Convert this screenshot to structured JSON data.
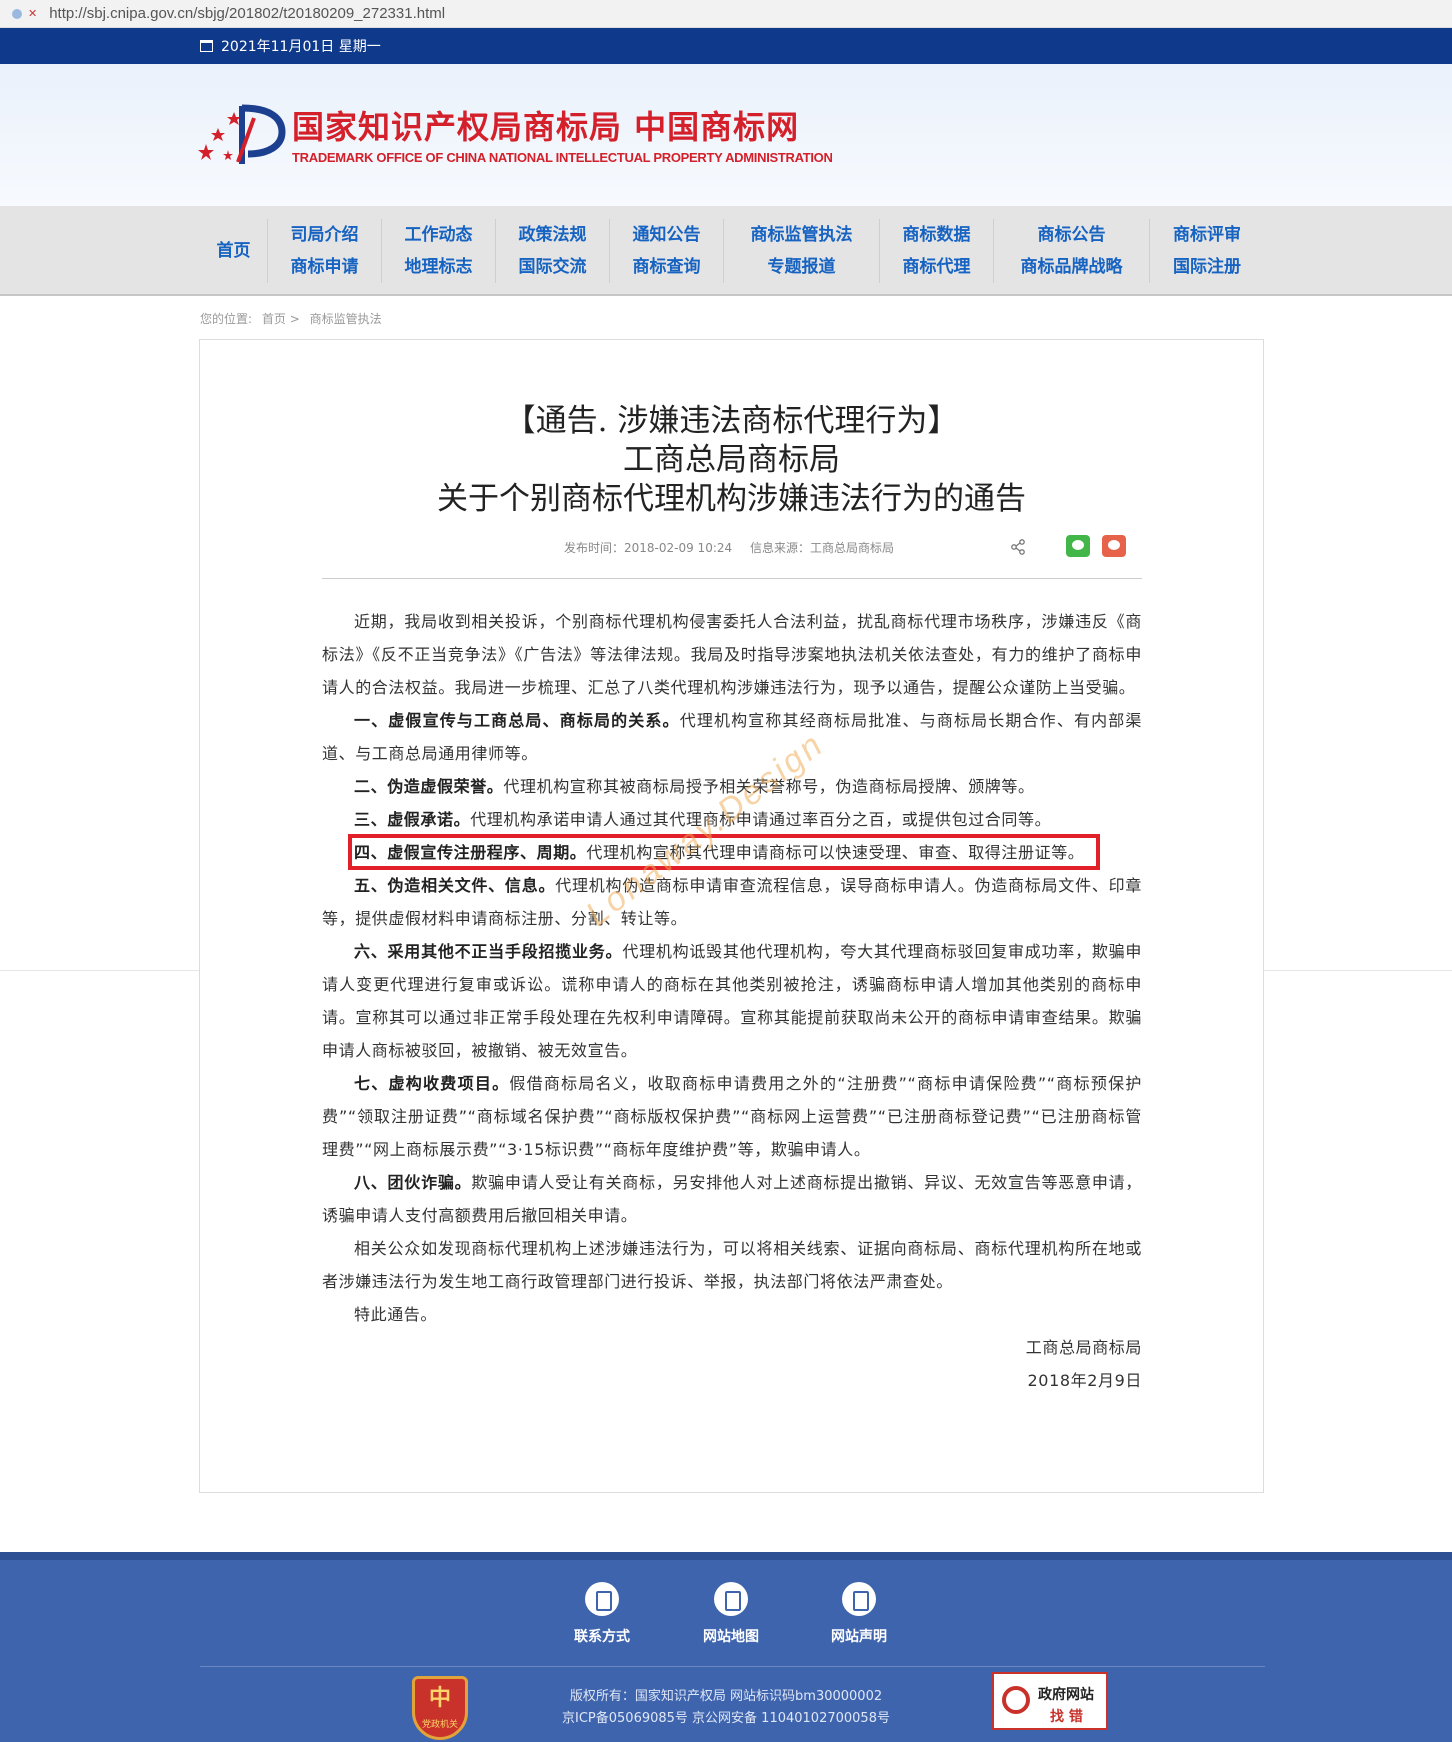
{
  "browser": {
    "url": "http://sbj.cnipa.gov.cn/sbjg/201802/t20180209_272331.html"
  },
  "topbar": {
    "date": "2021年11月01日 星期一"
  },
  "header": {
    "logo_cn": "国家知识产权局商标局 中国商标网",
    "logo_en": "TRADEMARK OFFICE OF CHINA NATIONAL INTELLECTUAL PROPERTY ADMINISTRATION",
    "brand_color": "#d3202a"
  },
  "nav": [
    {
      "top": "首页",
      "bottom": ""
    },
    {
      "top": "司局介绍",
      "bottom": "商标申请"
    },
    {
      "top": "工作动态",
      "bottom": "地理标志"
    },
    {
      "top": "政策法规",
      "bottom": "国际交流"
    },
    {
      "top": "通知公告",
      "bottom": "商标查询"
    },
    {
      "top": "商标监管执法",
      "bottom": "专题报道"
    },
    {
      "top": "商标数据",
      "bottom": "商标代理"
    },
    {
      "top": "商标公告",
      "bottom": "商标品牌战略"
    },
    {
      "top": "商标评审",
      "bottom": "国际注册"
    }
  ],
  "breadcrumb": {
    "label": "您的位置:",
    "home": "首页 >",
    "current": "商标监管执法"
  },
  "article": {
    "title_1": "【通告. 涉嫌违法商标代理行为】",
    "title_2": "工商总局商标局",
    "title_3": "关于个别商标代理机构涉嫌违法行为的通告",
    "publish_time": "发布时间：2018-02-09 10:24",
    "source": "信息来源：工商总局商标局",
    "intro": "近期，我局收到相关投诉，个别商标代理机构侵害委托人合法利益，扰乱商标代理市场秩序，涉嫌违反《商标法》《反不正当竞争法》《广告法》等法律法规。我局及时指导涉案地执法机关依法查处，有力的维护了商标申请人的合法权益。我局进一步梳理、汇总了八类代理机构涉嫌违法行为，现予以通告，提醒公众谨防上当受骗。",
    "items": [
      {
        "head": "一、虚假宣传与工商总局、商标局的关系。",
        "text": "代理机构宣称其经商标局批准、与商标局长期合作、有内部渠道、与工商总局通用律师等。"
      },
      {
        "head": "二、伪造虚假荣誉。",
        "text": "代理机构宣称其被商标局授予相关荣誉称号，伪造商标局授牌、颁牌等。"
      },
      {
        "head": "三、虚假承诺。",
        "text": "代理机构承诺申请人通过其代理商标申请通过率百分之百，或提供包过合同等。"
      },
      {
        "head": "四、虚假宣传注册程序、周期。",
        "text": "代理机构宣称其代理申请商标可以快速受理、审查、取得注册证等。"
      },
      {
        "head": "五、伪造相关文件、信息。",
        "text": "代理机构伪造商标申请审查流程信息，误导商标申请人。伪造商标局文件、印章等，提供虚假材料申请商标注册、分割、转让等。"
      },
      {
        "head": "六、采用其他不正当手段招揽业务。",
        "text": "代理机构诋毁其他代理机构，夸大其代理商标驳回复审成功率，欺骗申请人变更代理进行复审或诉讼。谎称申请人的商标在其他类别被抢注，诱骗商标申请人增加其他类别的商标申请。宣称其可以通过非正常手段处理在先权利申请障碍。宣称其能提前获取尚未公开的商标申请审查结果。欺骗申请人商标被驳回，被撤销、被无效宣告。"
      },
      {
        "head": "七、虚构收费项目。",
        "text": "假借商标局名义，收取商标申请费用之外的“注册费”“商标申请保险费”“商标预保护费”“领取注册证费”“商标域名保护费”“商标版权保护费”“商标网上运营费”“已注册商标登记费”“已注册商标管理费”“网上商标展示费”“3·15标识费”“商标年度维护费”等，欺骗申请人。"
      },
      {
        "head": "八、团伙诈骗。",
        "text": "欺骗申请人受让有关商标，另安排他人对上述商标提出撤销、异议、无效宣告等恶意申请，诱骗申请人支付高额费用后撤回相关申请。"
      }
    ],
    "closing": "相关公众如发现商标代理机构上述涉嫌违法行为，可以将相关线索、证据向商标局、商标代理机构所在地或者涉嫌违法行为发生地工商行政管理部门进行投诉、举报，执法部门将依法严肃查处。",
    "notice_end": "特此通告。",
    "signer": "工商总局商标局",
    "date": "2018年2月9日",
    "highlight_color": "#e2202a",
    "watermark": "Lonaway.Design"
  },
  "footer": {
    "links": [
      "联系方式",
      "网站地图",
      "网站声明"
    ],
    "badge_text": "党政机关",
    "copyright": "版权所有：国家知识产权局 网站标识码bm30000002",
    "icp": "京ICP备05069085号 京公网安备 11040102700058号",
    "gov_line1": "政府网站",
    "gov_line2": "找 错",
    "bg_color": "#3f64ae"
  }
}
